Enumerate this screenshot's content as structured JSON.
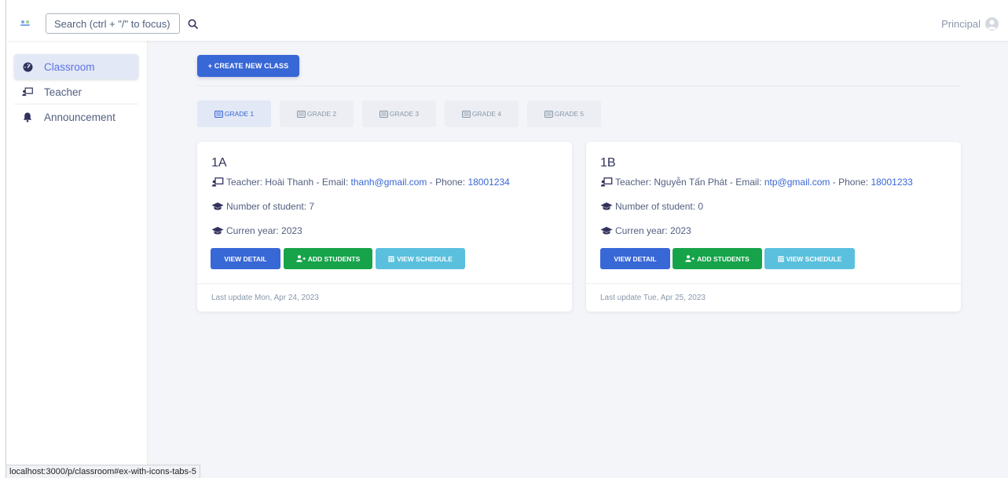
{
  "search": {
    "placeholder": "Search (ctrl + \"/\" to focus)"
  },
  "user": {
    "name": "Principal"
  },
  "sidebar": {
    "items": [
      {
        "label": "Classroom",
        "icon": "gauge-icon",
        "active": true
      },
      {
        "label": "Teacher",
        "icon": "chalkboard-teacher-icon",
        "active": false
      },
      {
        "label": "Announcement",
        "icon": "bell-icon",
        "active": false
      }
    ]
  },
  "main": {
    "create_button": "+ CREATE NEW CLASS",
    "tabs": [
      {
        "label": "GRADE 1",
        "active": true
      },
      {
        "label": "GRADE 2",
        "active": false
      },
      {
        "label": "GRADE 3",
        "active": false
      },
      {
        "label": "GRADE 4",
        "active": false
      },
      {
        "label": "GRADE 5",
        "active": false
      }
    ],
    "classes": [
      {
        "name": "1A",
        "teacher_prefix": "Teacher: Hoài Thanh - Email: ",
        "email": "thanh@gmail.com",
        "phone_prefix": " - Phone: ",
        "phone": "18001234",
        "students": "Number of student: 7",
        "year": "Curren year: 2023",
        "btn_detail": "VIEW DETAIL",
        "btn_add": "ADD STUDENTS",
        "btn_schedule": "VIEW SCHEDULE",
        "last_update": "Last update Mon, Apr 24, 2023"
      },
      {
        "name": "1B",
        "teacher_prefix": "Teacher: Nguyễn Tấn Phát - Email: ",
        "email": "ntp@gmail.com",
        "phone_prefix": " - Phone: ",
        "phone": "18001233",
        "students": "Number of student: 0",
        "year": "Curren year: 2023",
        "btn_detail": "VIEW DETAIL",
        "btn_add": "ADD STUDENTS",
        "btn_schedule": "VIEW SCHEDULE",
        "last_update": "Last update Tue, Apr 25, 2023"
      }
    ]
  },
  "status_bar": {
    "url": "localhost:3000/p/classroom#ex-with-icons-tabs-5"
  },
  "colors": {
    "primary": "#3867d6",
    "success": "#16a34a",
    "info": "#5bc0de",
    "background": "#f4f5f9"
  }
}
